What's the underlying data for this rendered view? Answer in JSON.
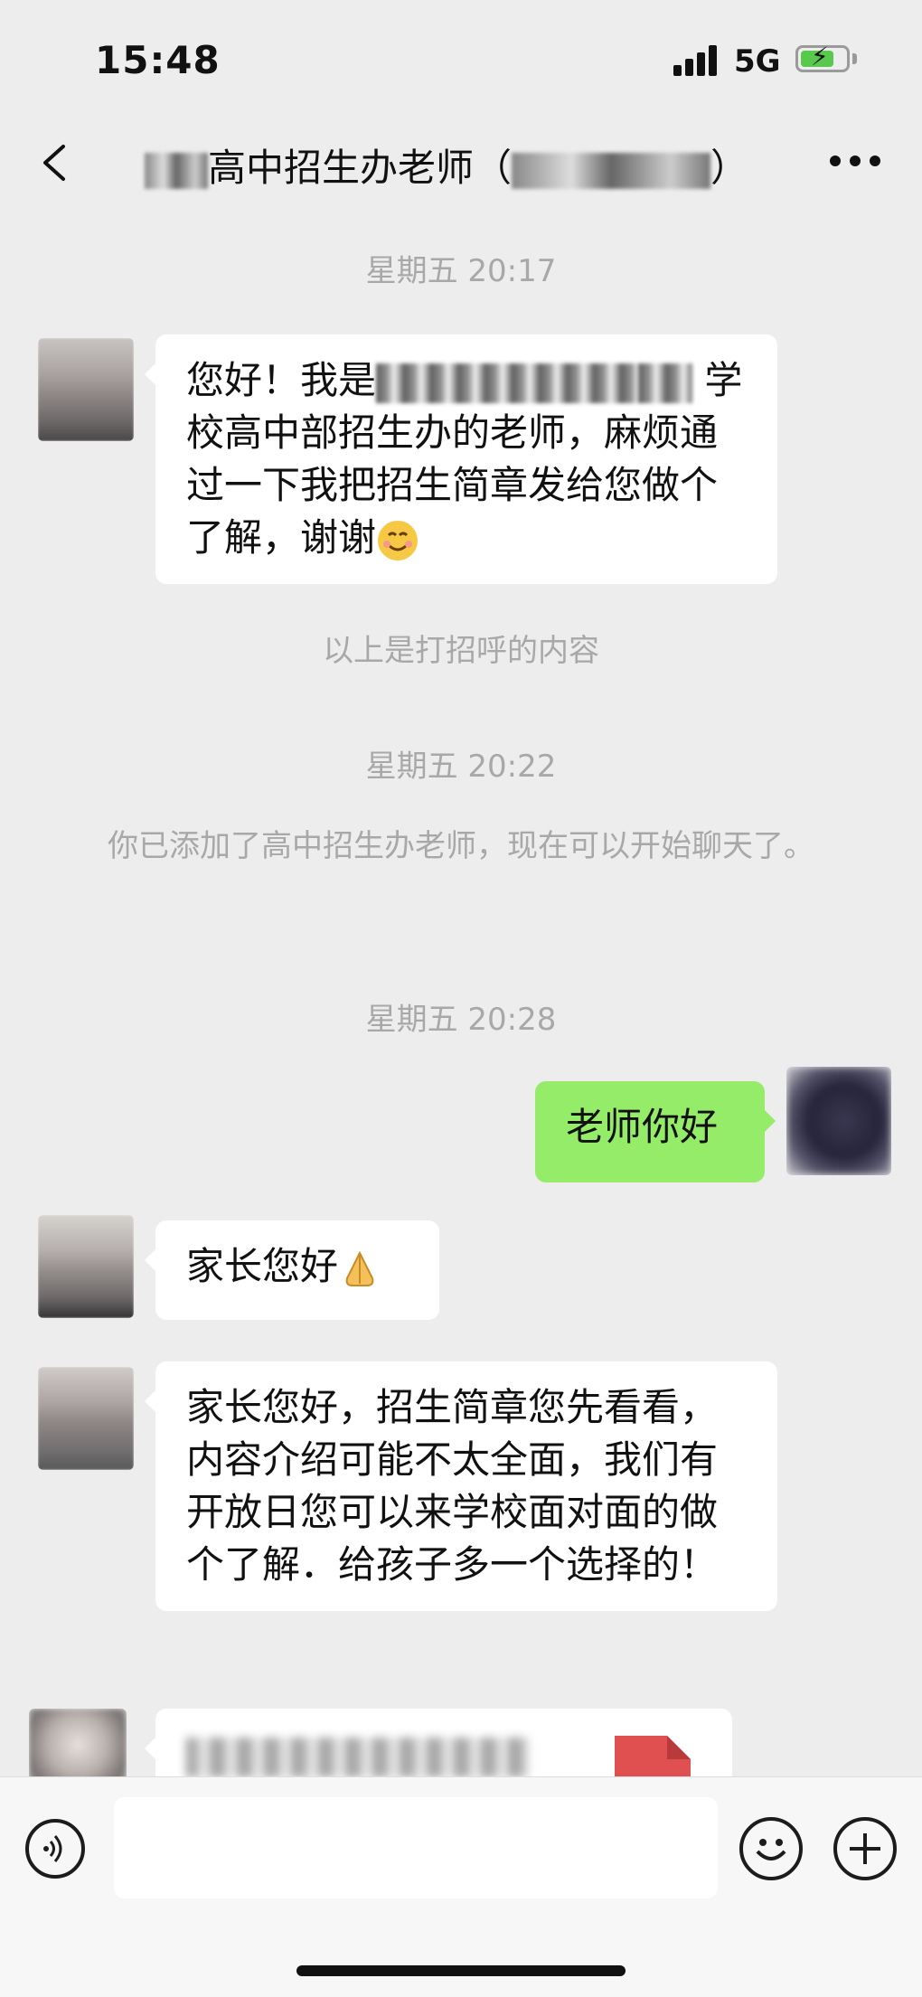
{
  "status_bar": {
    "time": "15:48",
    "network": "5G"
  },
  "nav": {
    "title_prefix": "高中招生办老师（",
    "title_suffix": "）"
  },
  "messages": {
    "time_1": "星期五 20:17",
    "greeting": {
      "part1": "您好！我是",
      "part2": "学校高中部招生办的老师，麻烦通过一下我把招生简章发给您做个了解，谢谢"
    },
    "greeting_note": "以上是打招呼的内容",
    "time_2": "星期五 20:22",
    "added_notice": "你已添加了高中招生办老师，现在可以开始聊天了。",
    "time_3": "星期五 20:28",
    "self_msg": "老师你好",
    "reply_1": "家长您好",
    "reply_2": "家长您好，招生简章您先看看，内容介绍可能不太全面，我们有开放日您可以来学校面对面的做个了解．给孩子多一个选择的！"
  },
  "colors": {
    "self_bubble": "#95ec69",
    "other_bubble": "#ffffff",
    "background": "#ededed",
    "file_icon": "#e05050"
  },
  "icons": [
    "back-icon",
    "more-icon",
    "voice-icon",
    "emoji-icon",
    "add-icon",
    "smile-emoji",
    "pray-emoji",
    "file-icon"
  ]
}
